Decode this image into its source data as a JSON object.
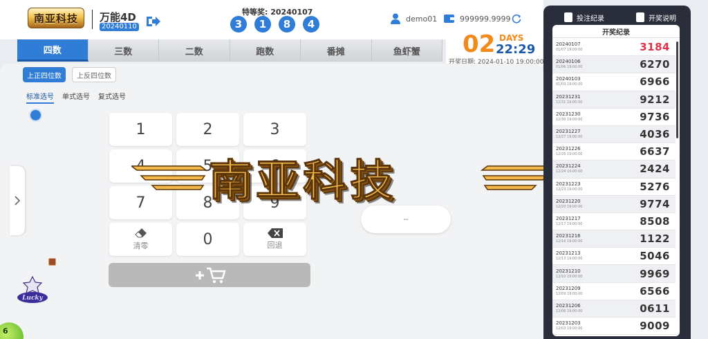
{
  "header": {
    "logo_text": "南亚科技",
    "game_title": "万能4D",
    "game_date": "20240110",
    "prize_label": "特等奖: 20240107",
    "prize_digits": [
      "3",
      "1",
      "8",
      "4"
    ],
    "username": "demo01",
    "balance": "999999.9999"
  },
  "tabs": [
    "四数",
    "三数",
    "二数",
    "跑数",
    "番摊",
    "鱼虾蟹"
  ],
  "countdown": {
    "days": "02",
    "days_label": "DAYS",
    "time": "22:29",
    "draw_date": "开奖日期: 2024-01-10 19:00:00"
  },
  "subtabs": {
    "primary": "上正四位数",
    "secondary": "上反四位数"
  },
  "pick_modes": [
    "标准选号",
    "单式选号",
    "复式选号"
  ],
  "keypad": {
    "keys": [
      "1",
      "2",
      "3",
      "4",
      "5",
      "6",
      "7",
      "8",
      "9"
    ],
    "clear_label": "清零",
    "zero": "0",
    "back_label": "回退"
  },
  "bet_display": "--",
  "watermark_text": "南亚科技",
  "lucky_ball": "6",
  "right_panel": {
    "bet_record_label": "投注纪录",
    "draw_info_label": "开奖说明",
    "results_title": "开奖纪录",
    "results": [
      {
        "date": "20240107",
        "sub": "01/07 19:00:00",
        "number": "3184"
      },
      {
        "date": "20240106",
        "sub": "01/06 19:00:00",
        "number": "6270"
      },
      {
        "date": "20240103",
        "sub": "01/03 19:00:00",
        "number": "6966"
      },
      {
        "date": "20231231",
        "sub": "12/31 19:00:00",
        "number": "9212"
      },
      {
        "date": "20231230",
        "sub": "12/30 19:00:00",
        "number": "9736"
      },
      {
        "date": "20231227",
        "sub": "12/27 19:00:00",
        "number": "4036"
      },
      {
        "date": "20231226",
        "sub": "12/26 19:00:00",
        "number": "6637"
      },
      {
        "date": "20231224",
        "sub": "12/24 19:00:00",
        "number": "2424"
      },
      {
        "date": "20231223",
        "sub": "12/23 19:00:00",
        "number": "5276"
      },
      {
        "date": "20231220",
        "sub": "12/20 19:00:00",
        "number": "9774"
      },
      {
        "date": "20231217",
        "sub": "12/17 19:00:00",
        "number": "8508"
      },
      {
        "date": "20231216",
        "sub": "12/16 19:00:00",
        "number": "1122"
      },
      {
        "date": "20231213",
        "sub": "12/13 19:00:00",
        "number": "5046"
      },
      {
        "date": "20231210",
        "sub": "12/10 19:00:00",
        "number": "9969"
      },
      {
        "date": "20231209",
        "sub": "12/09 19:00:00",
        "number": "6566"
      },
      {
        "date": "20231206",
        "sub": "12/06 19:00:00",
        "number": "0611"
      },
      {
        "date": "20231203",
        "sub": "12/03 19:00:00",
        "number": "9009"
      }
    ]
  },
  "colors": {
    "primary": "#2f7dd7",
    "countdown_orange": "#f28a1a",
    "latest_result": "#e0324a",
    "panel_dark": "#2a2e3a"
  },
  "icons": [
    "exit-icon",
    "user-icon",
    "wallet-icon",
    "refresh-icon",
    "chevron-right-icon",
    "info-icon",
    "eraser-icon",
    "backspace-icon",
    "cart-icon",
    "document-icon"
  ]
}
